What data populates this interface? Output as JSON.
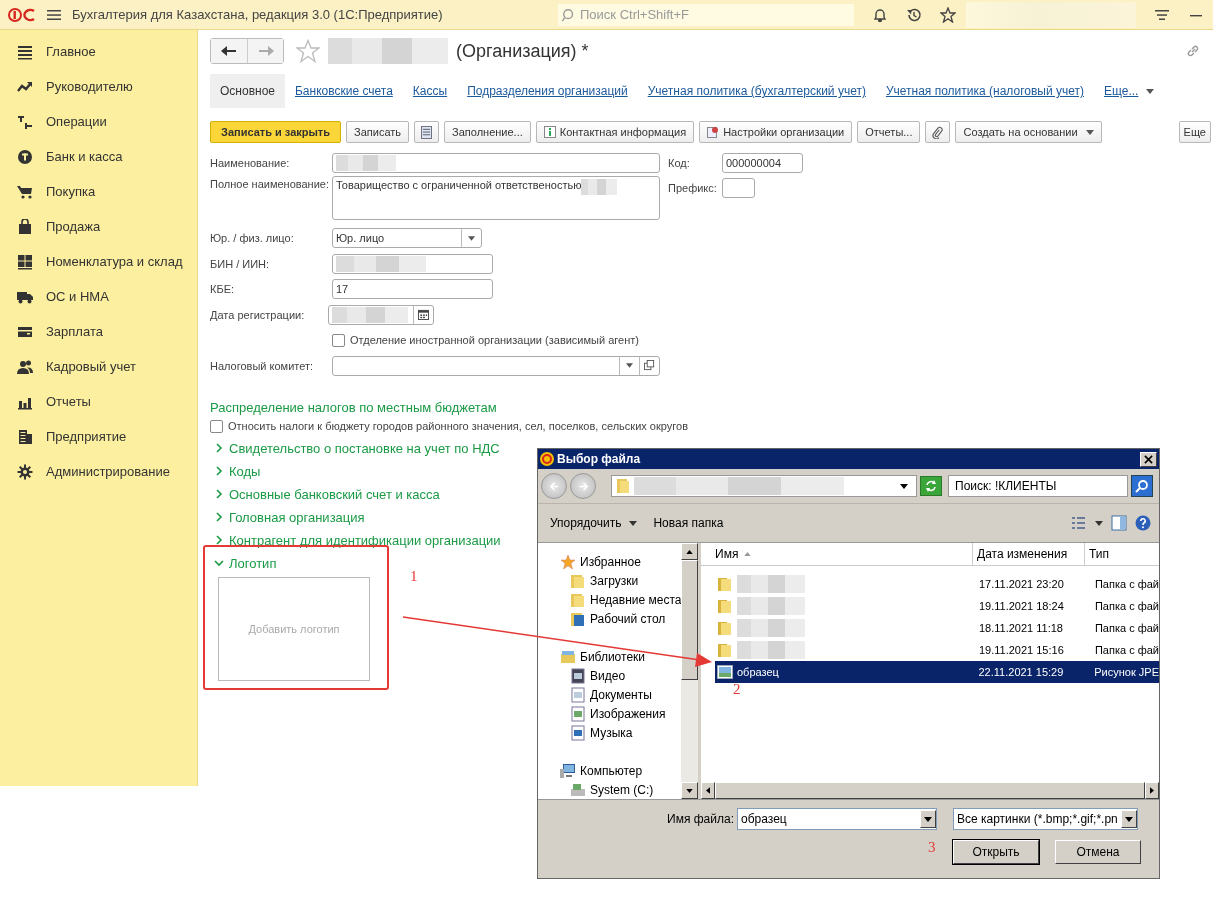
{
  "app": {
    "title": "Бухгалтерия для Казахстана, редакция 3.0  (1С:Предприятие)",
    "search": {
      "placeholder": "Поиск Ctrl+Shift+F"
    }
  },
  "sidebar": {
    "items": [
      {
        "label": "Главное"
      },
      {
        "label": "Руководителю"
      },
      {
        "label": "Операции"
      },
      {
        "label": "Банк и касса"
      },
      {
        "label": "Покупка"
      },
      {
        "label": "Продажа"
      },
      {
        "label": "Номенклатура и склад"
      },
      {
        "label": "ОС и НМА"
      },
      {
        "label": "Зарплата"
      },
      {
        "label": "Кадровый учет"
      },
      {
        "label": "Отчеты"
      },
      {
        "label": "Предприятие"
      },
      {
        "label": "Администрирование"
      }
    ]
  },
  "form": {
    "title": "(Организация) *",
    "tabs": [
      {
        "label": "Основное",
        "selected": true
      },
      {
        "label": "Банковские счета",
        "selected": false
      },
      {
        "label": "Кассы",
        "selected": false
      },
      {
        "label": "Подразделения организаций",
        "selected": false
      },
      {
        "label": "Учетная политика (бухгалтерский учет)",
        "selected": false
      },
      {
        "label": "Учетная политика (налоговый учет)",
        "selected": false
      },
      {
        "label": "Еще...",
        "selected": false
      }
    ],
    "toolbar": [
      {
        "kind": "primary",
        "label": "Записать и закрыть"
      },
      {
        "kind": "plain",
        "label": "Записать"
      },
      {
        "kind": "list"
      },
      {
        "kind": "plain",
        "label": "Заполнение..."
      },
      {
        "kind": "info",
        "label": "Контактная информация"
      },
      {
        "kind": "settings",
        "label": "Настройки организации"
      },
      {
        "kind": "plain",
        "label": "Отчеты..."
      },
      {
        "kind": "attach"
      },
      {
        "kind": "menu",
        "label": "Создать на основании"
      }
    ],
    "more_button": "Еще",
    "fields": [
      {
        "kind": "wide",
        "label": "Наименование:",
        "redacted": true
      },
      {
        "kind": "textarea",
        "label": "Полное наименование:",
        "value": "Товарищество с ограниченной ответственостью",
        "redacted": true
      },
      {
        "kind": "select",
        "label": "Юр. / физ. лицо:",
        "value": "Юр. лицо"
      },
      {
        "kind": "short",
        "label": "БИН / ИИН:",
        "redacted": true
      },
      {
        "kind": "short",
        "label": "КБЕ:",
        "value": "17"
      },
      {
        "kind": "date",
        "label": "Дата регистрации:",
        "redacted": true
      },
      {
        "kind": "checkbox",
        "label": "Отделение иностранной организации (зависимый агент)",
        "checked": false
      },
      {
        "kind": "reference",
        "label": "Налоговый комитет:"
      }
    ],
    "side_fields": [
      {
        "label": "Код:",
        "value": "000000004"
      },
      {
        "label": "Префикс:"
      }
    ],
    "section": {
      "heading": "Распределение налогов по местным бюджетам",
      "checkbox": {
        "label": "Относить налоги к бюджету городов районного значения, сел, поселков, сельских округов",
        "checked": false
      }
    },
    "groups": [
      {
        "label": "Свидетельство о постановке на учет по НДС",
        "expanded": false
      },
      {
        "label": "Коды",
        "expanded": false
      },
      {
        "label": "Основные банковский счет и касса",
        "expanded": false
      },
      {
        "label": "Головная организация",
        "expanded": false
      },
      {
        "label": "Контрагент для идентификации организации",
        "expanded": false
      },
      {
        "label": "Логотип",
        "expanded": true
      }
    ],
    "logo": {
      "placeholder": "Добавить логотип"
    }
  },
  "dialog": {
    "title": "Выбор файла",
    "search": {
      "placeholder": "Поиск: !КЛИЕНТЫ"
    },
    "toolbar": [
      {
        "kind": "menu",
        "label": "Упорядочить"
      },
      {
        "kind": "plain",
        "label": "Новая папка"
      }
    ],
    "nav": [
      {
        "label": "Избранное",
        "children": [
          {
            "label": "Загрузки"
          },
          {
            "label": "Недавние места"
          },
          {
            "label": "Рабочий стол"
          }
        ]
      },
      {
        "label": "Библиотеки",
        "children": [
          {
            "label": "Видео"
          },
          {
            "label": "Документы"
          },
          {
            "label": "Изображения"
          },
          {
            "label": "Музыка"
          }
        ]
      },
      {
        "label": "Компьютер",
        "children": [
          {
            "label": "System (C:)"
          }
        ]
      }
    ],
    "columns": [
      "Имя",
      "Дата изменения",
      "Тип"
    ],
    "rows": [
      {
        "kind": "folder",
        "redacted": true,
        "date": "17.11.2021 23:20",
        "type": "Папка с фай",
        "selected": false
      },
      {
        "kind": "folder",
        "redacted": true,
        "date": "19.11.2021 18:24",
        "type": "Папка с фай",
        "selected": false
      },
      {
        "kind": "folder",
        "redacted": true,
        "date": "18.11.2021 11:18",
        "type": "Папка с фай",
        "selected": false
      },
      {
        "kind": "folder",
        "redacted": true,
        "date": "19.11.2021 15:16",
        "type": "Папка с фай",
        "selected": false
      },
      {
        "kind": "image",
        "name": "образец",
        "date": "22.11.2021 15:29",
        "type": "Рисунок JPE",
        "selected": true
      }
    ],
    "filename_label": "Имя файла:",
    "filename": "образец",
    "filter": "Все картинки (*.bmp;*.gif;*.pn",
    "buttons": [
      "Открыть",
      "Отмена"
    ]
  },
  "annotations": [
    "1",
    "2",
    "3"
  ]
}
